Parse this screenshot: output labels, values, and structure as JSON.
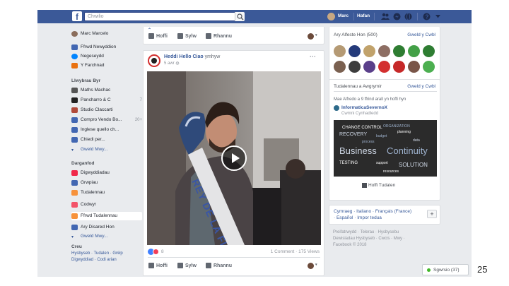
{
  "topbar": {
    "search_placeholder": "Chwilio",
    "user": "Marc",
    "home": "Hafan"
  },
  "sidebar": {
    "profile": "Marc Marcelo",
    "items": [
      {
        "label": "Ffrwd Newyddion",
        "color": "#4267b2"
      },
      {
        "label": "Negeseydd",
        "color": "#0084ff"
      },
      {
        "label": "Y Farchnad",
        "color": "#e9710f"
      }
    ],
    "shortcuts_header": "Llwybrau Byr",
    "shortcuts": [
      {
        "label": "Maths Machac",
        "count": ""
      },
      {
        "label": "Pancharro & C",
        "count": "7"
      },
      {
        "label": "Studio Claccarti",
        "count": ""
      },
      {
        "label": "Compro Vendo Bo...",
        "count": "20+"
      },
      {
        "label": "Inglese quello ch...",
        "count": ""
      },
      {
        "label": "Chiedi per...",
        "count": ""
      }
    ],
    "see_more": "Gweld Mwy...",
    "explore_header": "Darganfod",
    "explore": [
      {
        "label": "Digwyddiadau",
        "color": "#f02849"
      },
      {
        "label": "Grwpiau",
        "color": "#4267b2"
      },
      {
        "label": "Tudalennau",
        "color": "#f7923b"
      },
      {
        "label": "Codwyr",
        "color": "#f35369"
      },
      {
        "label": "Ffrwd Tudalennau",
        "color": "#f7923b"
      },
      {
        "label": "Ary Disared Hon",
        "color": "#4267b2"
      }
    ],
    "see_more2": "Gweld Mwy...",
    "create_header": "Creu",
    "create_links": "Hysbyseb · Tudalen · Grŵp",
    "create_links2": "Digwyddiad · Codi arian"
  },
  "top_actions": {
    "like": "Hoffi",
    "comment": "Sylw",
    "share": "Rhannu"
  },
  "post": {
    "page": "Heddi Hello Ciao",
    "verb": "ymhyw",
    "time": "5 awr",
    "reactions_count": "8",
    "stats": "1 Comment · 175 Views",
    "sash_text": "REY DE LA FI"
  },
  "actions": {
    "like": "Hoffi",
    "comment": "Sylw",
    "share": "Rhannu"
  },
  "right": {
    "people_title": "Ary Alfeste Hon (500)",
    "people_link": "Gweld y Cwbl",
    "pages_title": "Tudalennau a Awgrymir",
    "pages_link": "Gweld y Cwbl",
    "suggestion_line": "Mae Alfredo a 9 ffrind arall yn hoffi hyn",
    "suggestion_name": "InformaticaSevernoX",
    "suggestion_type": "Cwmni Cynhadledd",
    "suggestion_like": "Hoffi Tudalen",
    "lang_line1": "Cymraeg · Italiano · Français (France)",
    "lang_line2": "· Español · Impor tedua",
    "footer1": "Preifatrwydd · Telerau · Hysbysebu",
    "footer2": "Dewisiadau Hysbyseb · Cwcis · Mwy ·",
    "footer3": "Facebook © 2018",
    "chat": "Sgwrsio (37)"
  },
  "wordcloud": {
    "words": [
      "CHANGE CONTROL",
      "RECOVERY",
      "ORGANIZATION",
      "planning",
      "Business",
      "Continuity",
      "TESTING",
      "SOLUTION",
      "process",
      "support",
      "data",
      "budget",
      "resources"
    ]
  },
  "slide_number": "25",
  "colors": {
    "fb_blue": "#3b5998",
    "bg": "#e9ebee",
    "link": "#365899"
  }
}
